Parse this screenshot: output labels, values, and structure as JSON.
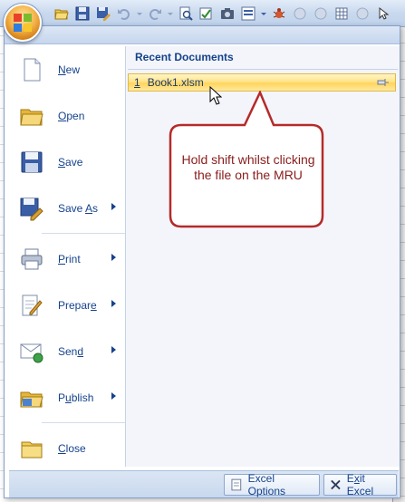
{
  "menu": {
    "items": [
      {
        "accel": "N",
        "rest": "ew",
        "icon": "new-document-icon",
        "arrow": false
      },
      {
        "accel": "O",
        "rest": "pen",
        "icon": "open-folder-icon",
        "arrow": false
      },
      {
        "accel": "S",
        "rest": "ave",
        "icon": "save-disk-icon",
        "arrow": false
      },
      {
        "accel": "Save ",
        "rest": "",
        "accel2": "A",
        "rest2": "s",
        "icon": "save-as-icon",
        "arrow": true
      },
      {
        "accel": "P",
        "rest": "rint",
        "icon": "printer-icon",
        "arrow": true
      },
      {
        "accel": "Prepar",
        "rest": "",
        "accel2": "e",
        "rest2": "",
        "icon": "prepare-icon",
        "arrow": true
      },
      {
        "accel": "Sen",
        "rest": "",
        "accel2": "d",
        "rest2": "",
        "icon": "send-icon",
        "arrow": true
      },
      {
        "accel": "P",
        "rest": "",
        "accel2": "u",
        "rest2": "blish",
        "icon": "publish-icon",
        "arrow": true
      },
      {
        "accel": "C",
        "rest": "lose",
        "icon": "close-folder-icon",
        "arrow": false
      }
    ]
  },
  "recent": {
    "header": "Recent Documents",
    "items": [
      {
        "num": "1",
        "name": "Book1.xlsm"
      }
    ]
  },
  "callout": {
    "text": "Hold shift whilst clicking the file on the MRU"
  },
  "bottom": {
    "options_label_pre": "Excel Options",
    "exit_accel": "x",
    "exit_pre": "E",
    "exit_post": "it Excel"
  },
  "colors": {
    "accent": "#15428b",
    "highlight": "#ffd55a",
    "callout_border": "#b52a2a",
    "callout_text": "#8a1c1c"
  }
}
